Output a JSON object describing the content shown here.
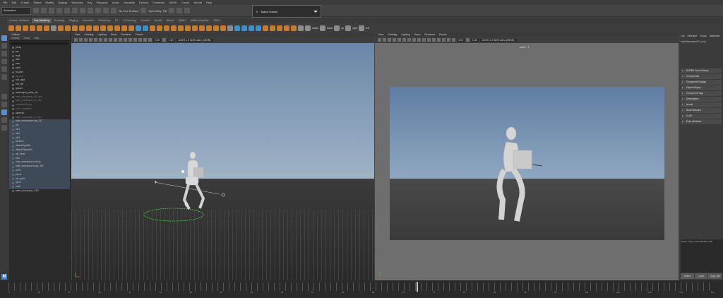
{
  "menubar": {
    "items": [
      "File",
      "Edit",
      "Create",
      "Select",
      "Modify",
      "Display",
      "Windows",
      "Key",
      "Playback",
      "Audio",
      "Visualize",
      "Deform",
      "Constrain",
      "MASH",
      "Cache",
      "Arnold",
      "Help"
    ]
  },
  "statusline": {
    "mode": "Animation",
    "live_surface": "No Live Surface",
    "symmetry": "Symmetry: Off"
  },
  "workspace": {
    "label": "Maya Classic"
  },
  "shelf_tabs": [
    "Curves / Surfaces",
    "Poly Modeling",
    "Sculpting",
    "Rigging",
    "Animation",
    "Rendering",
    "FX",
    "FX Caching",
    "Custom",
    "Arnold",
    "Bifrost",
    "MASH",
    "Motion Graphics",
    "XGen"
  ],
  "shelf_labels": [
    "rotate",
    "down",
    "up",
    "right",
    "left"
  ],
  "outliner": {
    "title": "Outliner",
    "menu": [
      "Display",
      "Show",
      "Help"
    ],
    "rows": [
      {
        "name": "persp",
        "hl": false,
        "dim": false
      },
      {
        "name": "top",
        "hl": false,
        "dim": false
      },
      {
        "name": "front",
        "hl": false,
        "dim": false
      },
      {
        "name": "side",
        "hl": false,
        "dim": false
      },
      {
        "name": "cam",
        "hl": false,
        "dim": false
      },
      {
        "name": "cam1",
        "hl": false,
        "dim": false
      },
      {
        "name": "pCube1",
        "hl": false,
        "dim": false
      },
      {
        "name": "rig_root",
        "hl": false,
        "dim": true
      },
      {
        "name": "box_right",
        "hl": false,
        "dim": false
      },
      {
        "name": "box_left",
        "hl": false,
        "dim": false
      },
      {
        "name": "group1",
        "hl": false,
        "dim": false
      },
      {
        "name": "mannequin_paths_ctrl",
        "hl": false,
        "dim": false
      },
      {
        "name": "male_mannequin_FK_ctrls",
        "hl": false,
        "dim": true
      },
      {
        "name": "male_mannequin_IK_ctrls",
        "hl": false,
        "dim": true
      },
      {
        "name": "constraintGroup",
        "hl": false,
        "dim": true
      },
      {
        "name": "point_constraint",
        "hl": false,
        "dim": true
      },
      {
        "name": "camera1",
        "hl": false,
        "dim": false
      },
      {
        "name": "male_mannequin_fk_ctrls",
        "hl": false,
        "dim": true
      },
      {
        "name": "male_mannequin:ring_JNT",
        "hl": true,
        "dim": false
      },
      {
        "name": "ctrl",
        "hl": true,
        "dim": false
      },
      {
        "name": "ctrl1",
        "hl": true,
        "dim": false
      },
      {
        "name": "ctrl2",
        "hl": true,
        "dim": false
      },
      {
        "name": "ctrl3",
        "hl": true,
        "dim": false
      },
      {
        "name": "skeleton",
        "hl": true,
        "dim": false
      },
      {
        "name": "defaultLightSet",
        "hl": true,
        "dim": false
      },
      {
        "name": "defaultObjectSet",
        "hl": true,
        "dim": false
      },
      {
        "name": "ctrl_hand",
        "hl": true,
        "dim": false
      },
      {
        "name": "ctrl4",
        "hl": true,
        "dim": false
      },
      {
        "name": "male_mannequin:ctrl_hip",
        "hl": true,
        "dim": false
      },
      {
        "name": "male_mannequin:body_JNT",
        "hl": true,
        "dim": false
      },
      {
        "name": "chest",
        "hl": true,
        "dim": false
      },
      {
        "name": "pelvis",
        "hl": true,
        "dim": false
      },
      {
        "name": "ctrl_spine",
        "hl": true,
        "dim": false
      },
      {
        "name": "spine",
        "hl": true,
        "dim": false
      },
      {
        "name": "neck",
        "hl": true,
        "dim": false
      },
      {
        "name": "male_mannequin_GEO",
        "hl": false,
        "dim": false
      }
    ]
  },
  "viewport_left": {
    "menu": [
      "View",
      "Shading",
      "Lighting",
      "Show",
      "Renderer",
      "Panels"
    ],
    "num1": "0.00",
    "num2": "1.00",
    "colorspace": "ACES 1.0 SDR-video (sRGB)"
  },
  "viewport_right": {
    "menu": [
      "View",
      "Shading",
      "Lighting",
      "Show",
      "Renderer",
      "Panels"
    ],
    "num1": "0.00",
    "num2": "1.00",
    "colorspace": "ACES 1.0 SDR-video (sRGB)",
    "camera_label": "cam1 : 1"
  },
  "attribute_editor": {
    "tabs": [
      "List",
      "Selected",
      "Focus",
      "Attributes"
    ],
    "node": "maleMannequinFK_body",
    "sections": [
      {
        "label": "NURBS Curve History",
        "open": true
      },
      {
        "label": "Components",
        "open": false
      },
      {
        "label": "Component Display",
        "open": false
      },
      {
        "label": "Object Display",
        "open": false
      },
      {
        "label": "Component Tags",
        "open": false
      },
      {
        "label": "Deformation",
        "open": false
      },
      {
        "label": "Arnold",
        "open": false
      },
      {
        "label": "Node Behavior",
        "open": false
      },
      {
        "label": "UUID",
        "open": false
      },
      {
        "label": "Extra Attributes",
        "open": false
      }
    ],
    "notes": "Notes: male_mannequinFK_body",
    "buttons": [
      "Select",
      "Load Attributes",
      "Copy Tab"
    ]
  },
  "timeline": {
    "labels": [
      "5",
      "10",
      "15",
      "20",
      "25",
      "30",
      "35",
      "40",
      "45",
      "50",
      "55",
      "60",
      "65",
      "70",
      "75",
      "80",
      "85",
      "90",
      "95",
      "100",
      "105",
      "110",
      "115",
      "120"
    ]
  },
  "colors": {
    "accent": "#5c8fc7",
    "shelf_orange": "#c77b2e",
    "selection": "#3f4a58"
  }
}
